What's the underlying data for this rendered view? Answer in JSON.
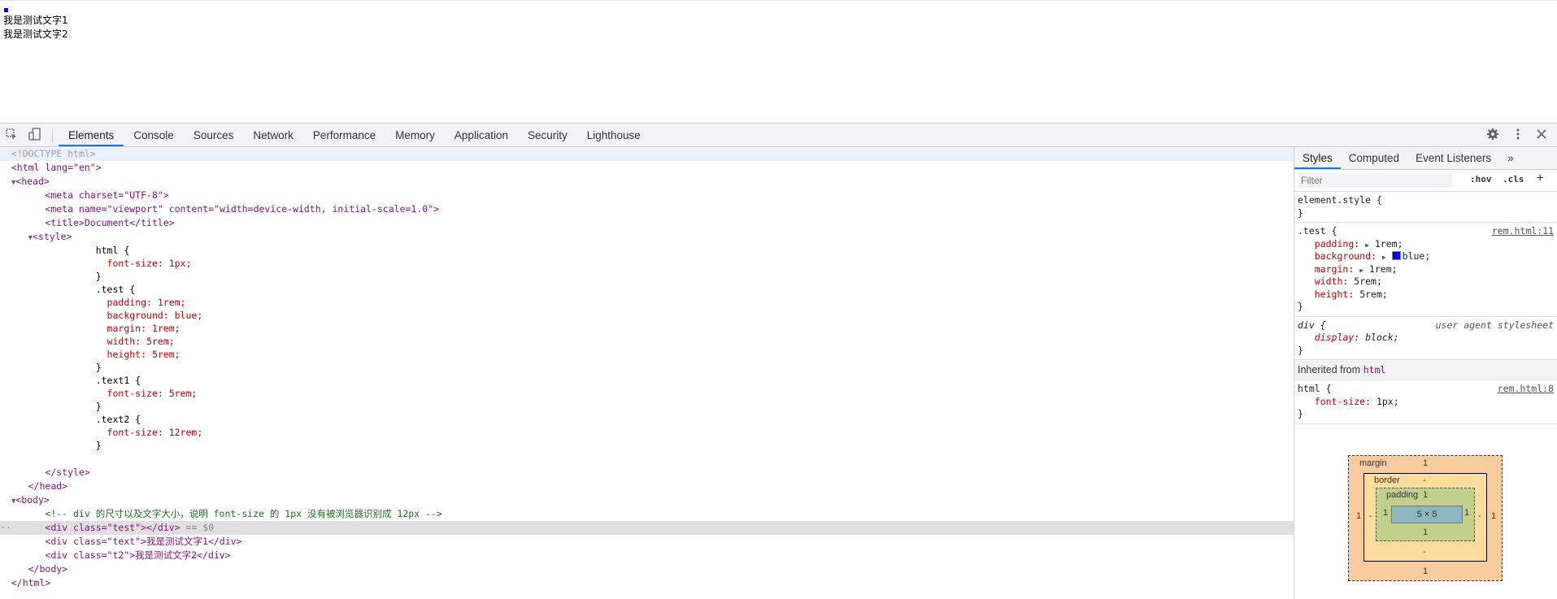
{
  "page": {
    "text1": "我是测试文字1",
    "text2": "我是测试文字2",
    "box_color": "#0000ff"
  },
  "toolbar": {
    "tabs": [
      "Elements",
      "Console",
      "Sources",
      "Network",
      "Performance",
      "Memory",
      "Application",
      "Security",
      "Lighthouse"
    ],
    "active_tab": "Elements",
    "icons": [
      "inspect-element-icon",
      "device-toolbar-icon",
      "gear-icon",
      "more-vert-icon",
      "close-icon"
    ],
    "accent": "#1a73e8"
  },
  "dom": {
    "doctype": "<!DOCTYPE html>",
    "html_open": "<html lang=\"en\">",
    "head": "<head>",
    "meta_charset": "<meta charset=\"UTF-8\">",
    "meta_viewport": "<meta name=\"viewport\" content=\"width=device-width, initial-scale=1.0\">",
    "title": "<title>Document</title>",
    "style_open": "<style>",
    "css": [
      "html {",
      "  font-size: 1px;",
      "}",
      ".test {",
      "  padding: 1rem;",
      "  background: blue;",
      "  margin: 1rem;",
      "  width: 5rem;",
      "  height: 5rem;",
      "}",
      ".text1 {",
      "  font-size: 5rem;",
      "}",
      ".text2 {",
      "  font-size: 12rem;",
      "}"
    ],
    "style_close": "</style>",
    "head_close": "</head>",
    "body_open": "<body>",
    "comment": "<!-- div 的尺寸以及文字大小，说明 font-size 的 1px 没有被浏览器识别成 12px -->",
    "div_test": "<div class=\"test\"></div>",
    "selected_marker": "== $0",
    "div_text": "<div class=\"text\">我是测试文字1</div>",
    "div_t2": "<div class=\"t2\">我是测试文字2</div>",
    "body_close": "</body>",
    "html_close": "</html>"
  },
  "styles_pane": {
    "tabs": [
      "Styles",
      "Computed",
      "Event Listeners"
    ],
    "more": "»",
    "filter_placeholder": "Filter",
    "hov": ":hov",
    "cls": ".cls",
    "add": "+",
    "element_style": "element.style {",
    "close_brace": "}",
    "test_rule": {
      "selector": ".test {",
      "source": "rem.html:11",
      "decls": [
        {
          "prop": "padding",
          "value": "1rem;"
        },
        {
          "prop": "background",
          "value": "blue;"
        },
        {
          "prop": "margin",
          "value": "1rem;"
        },
        {
          "prop": "width",
          "value": "5rem;"
        },
        {
          "prop": "height",
          "value": "5rem;"
        }
      ]
    },
    "ua_rule": {
      "selector": "div {",
      "source": "user agent stylesheet",
      "prop": "display",
      "value": "block;"
    },
    "inherited_label": "Inherited from",
    "inherited_tag": "html",
    "html_rule": {
      "selector": "html {",
      "source": "rem.html:8",
      "prop": "font-size",
      "value": "1px;"
    }
  },
  "box_model": {
    "margin_label": "margin",
    "border_label": "border",
    "padding_label": "padding",
    "margin": "1",
    "border": "-",
    "padding": "1",
    "content": "5 × 5"
  }
}
